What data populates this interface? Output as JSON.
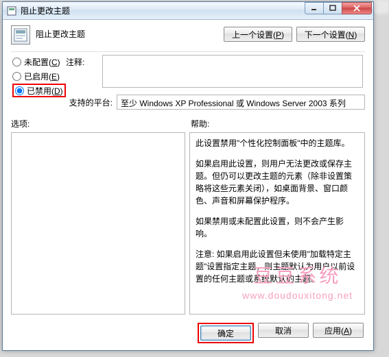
{
  "window": {
    "title": "阻止更改主题"
  },
  "header": {
    "title": "阻止更改主题",
    "prev_btn": "上一个设置(P)",
    "next_btn": "下一个设置(N)"
  },
  "radios": {
    "not_configured": "未配置(C)",
    "enabled": "已启用(E)",
    "disabled": "已禁用(D)",
    "selected": "disabled"
  },
  "comment": {
    "label": "注释:"
  },
  "platform": {
    "label": "支持的平台:",
    "value": "至少 Windows XP Professional 或 Windows Server 2003 系列"
  },
  "labels": {
    "options": "选项:",
    "help": "帮助:"
  },
  "help": {
    "p1": "此设置禁用\"个性化控制面板\"中的主题库。",
    "p2": "如果启用此设置，则用户无法更改或保存主题。但仍可以更改主题的元素（除非设置策略将这些元素关闭），如桌面背景、窗口颜色、声音和屏幕保护程序。",
    "p3": "如果禁用或未配置此设置，则不会产生影响。",
    "p4": "注意: 如果启用此设置但未使用\"加载特定主题\"设置指定主题，则主题默认为用户以前设置的任何主题或系统默认的主题。"
  },
  "footer": {
    "ok": "确定",
    "cancel": "取消",
    "apply": "应用(A)"
  },
  "watermark": {
    "line1": "豆豆系统",
    "line2": "www.doudouxitong.net"
  }
}
